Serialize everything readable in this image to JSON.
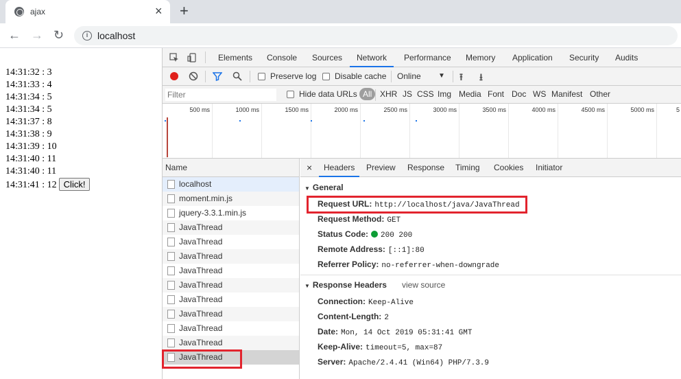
{
  "browser": {
    "tab_title": "ajax",
    "url": "localhost"
  },
  "page": {
    "lines": [
      "14:31:32 : 3",
      "14:31:33 : 4",
      "14:31:34 : 5",
      "14:31:34 : 5",
      "14:31:37 : 8",
      "14:31:38 : 9",
      "14:31:39 : 10",
      "14:31:40 : 11",
      "14:31:40 : 11",
      "14:31:41 : 12"
    ],
    "button_label": "Click!"
  },
  "devtools": {
    "tabs": [
      "Elements",
      "Console",
      "Sources",
      "Network",
      "Performance",
      "Memory",
      "Application",
      "Security",
      "Audits"
    ],
    "active_tab": "Network",
    "net_toolbar": {
      "preserve_log": "Preserve log",
      "disable_cache": "Disable cache",
      "throttle": "Online"
    },
    "filter": {
      "placeholder": "Filter",
      "hide_data_urls": "Hide data URLs",
      "types": [
        "All",
        "XHR",
        "JS",
        "CSS",
        "Img",
        "Media",
        "Font",
        "Doc",
        "WS",
        "Manifest",
        "Other"
      ]
    },
    "timeline_ticks": [
      "500 ms",
      "1000 ms",
      "1500 ms",
      "2000 ms",
      "2500 ms",
      "3000 ms",
      "3500 ms",
      "4000 ms",
      "4500 ms",
      "5000 ms",
      "5"
    ],
    "name_header": "Name",
    "requests": [
      "localhost",
      "moment.min.js",
      "jquery-3.3.1.min.js",
      "JavaThread",
      "JavaThread",
      "JavaThread",
      "JavaThread",
      "JavaThread",
      "JavaThread",
      "JavaThread",
      "JavaThread",
      "JavaThread",
      "JavaThread"
    ],
    "detail_tabs": [
      "Headers",
      "Preview",
      "Response",
      "Timing",
      "Cookies",
      "Initiator"
    ],
    "general": {
      "title": "General",
      "request_url_key": "Request URL:",
      "request_url_val": "http://localhost/java/JavaThread",
      "request_method_key": "Request Method:",
      "request_method_val": "GET",
      "status_code_key": "Status Code:",
      "status_code_val": "200 200",
      "remote_address_key": "Remote Address:",
      "remote_address_val": "[::1]:80",
      "referrer_policy_key": "Referrer Policy:",
      "referrer_policy_val": "no-referrer-when-downgrade"
    },
    "response_headers": {
      "title": "Response Headers",
      "view_source": "view source",
      "rows": [
        {
          "k": "Connection:",
          "v": "Keep-Alive"
        },
        {
          "k": "Content-Length:",
          "v": "2"
        },
        {
          "k": "Date:",
          "v": "Mon, 14 Oct 2019 05:31:41 GMT"
        },
        {
          "k": "Keep-Alive:",
          "v": "timeout=5, max=87"
        },
        {
          "k": "Server:",
          "v": "Apache/2.4.41 (Win64) PHP/7.3.9"
        }
      ]
    }
  },
  "colors": {
    "accent": "#1a73e8",
    "highlight": "#e2242e",
    "status_ok": "#0d9d35"
  }
}
